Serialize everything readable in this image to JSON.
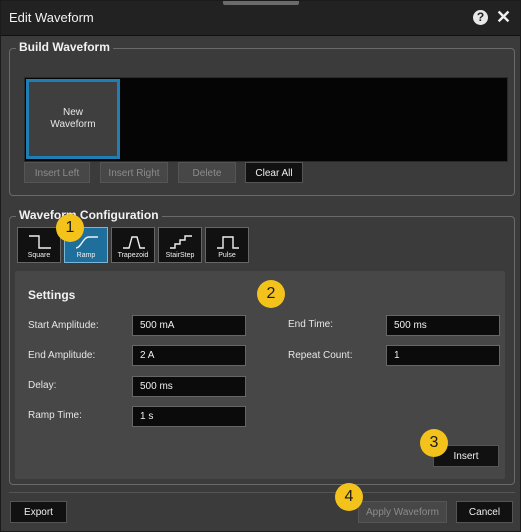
{
  "window": {
    "title": "Edit Waveform",
    "help_glyph": "?",
    "close_glyph": "✕"
  },
  "build": {
    "title": "Build Waveform",
    "tile_line1": "New",
    "tile_line2": "Waveform",
    "buttons": {
      "insert_left": "Insert Left",
      "insert_right": "Insert Right",
      "delete": "Delete",
      "clear_all": "Clear All"
    }
  },
  "config": {
    "title": "Waveform Configuration",
    "shapes": [
      {
        "label": "Square",
        "icon": "square-wave-icon",
        "selected": false
      },
      {
        "label": "Ramp",
        "icon": "ramp-wave-icon",
        "selected": true
      },
      {
        "label": "Trapezoid",
        "icon": "trapezoid-wave-icon",
        "selected": false
      },
      {
        "label": "StairStep",
        "icon": "stairstep-wave-icon",
        "selected": false
      },
      {
        "label": "Pulse",
        "icon": "pulse-wave-icon",
        "selected": false
      }
    ],
    "settings": {
      "title": "Settings",
      "start_amplitude": {
        "label": "Start Amplitude:",
        "value": "500 mA"
      },
      "end_amplitude": {
        "label": "End Amplitude:",
        "value": "2 A"
      },
      "delay": {
        "label": "Delay:",
        "value": "500 ms"
      },
      "ramp_time": {
        "label": "Ramp Time:",
        "value": "1 s"
      },
      "end_time": {
        "label": "End Time:",
        "value": "500 ms"
      },
      "repeat_count": {
        "label": "Repeat Count:",
        "value": "1"
      }
    },
    "insert_label": "Insert"
  },
  "footer": {
    "export": "Export",
    "apply": "Apply Waveform",
    "cancel": "Cancel"
  },
  "callouts": [
    "1",
    "2",
    "3",
    "4"
  ],
  "colors": {
    "accent": "#1f6f9c",
    "callout": "#f3c21b",
    "background": "#3b3b3b"
  }
}
